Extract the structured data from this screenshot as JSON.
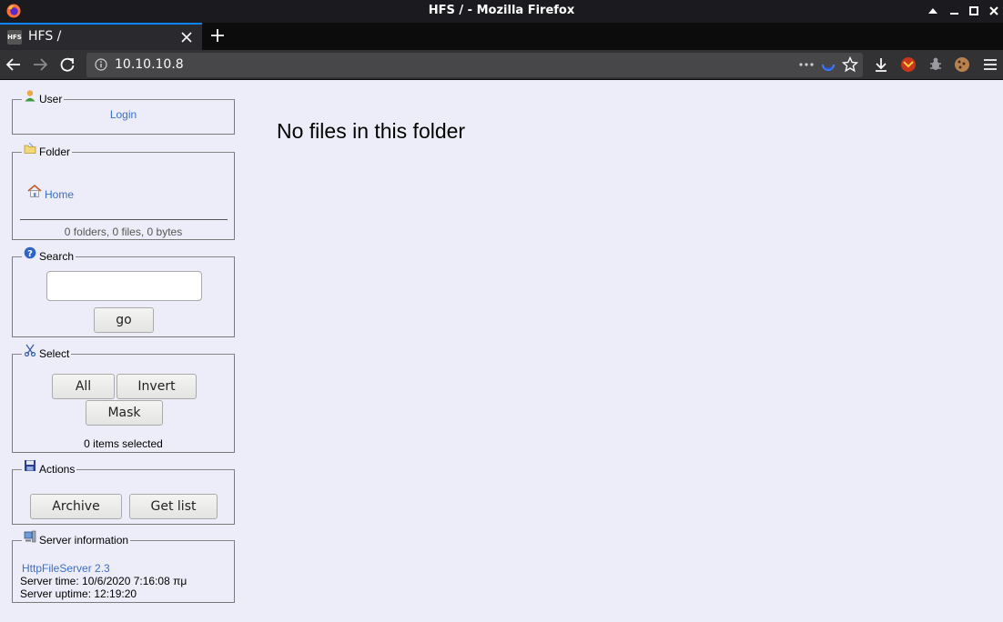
{
  "window": {
    "title": "HFS / - Mozilla Firefox"
  },
  "tabs": [
    {
      "label": "HFS /",
      "favicon": "HFS",
      "active": true
    }
  ],
  "navbar": {
    "url": "10.10.10.8"
  },
  "panels": {
    "user": {
      "legend": "User",
      "login_link": "Login"
    },
    "folder": {
      "legend": "Folder",
      "home_link": "Home",
      "summary": "0 folders, 0 files, 0 bytes"
    },
    "search": {
      "legend": "Search",
      "input_value": "",
      "go_label": "go"
    },
    "select": {
      "legend": "Select",
      "all_label": "All",
      "invert_label": "Invert",
      "mask_label": "Mask",
      "status": "0 items selected"
    },
    "actions": {
      "legend": "Actions",
      "archive_label": "Archive",
      "getlist_label": "Get list"
    },
    "server": {
      "legend": "Server information",
      "version_link": "HttpFileServer 2.3",
      "server_time": "Server time: 10/6/2020 7:16:08 πμ",
      "server_uptime": "Server uptime: 12:19:20"
    }
  },
  "main": {
    "message": "No files in this folder"
  },
  "colors": {
    "page_background": "#ededf9",
    "link": "#3a6fc4",
    "tab_accent": "#0a84ff"
  }
}
